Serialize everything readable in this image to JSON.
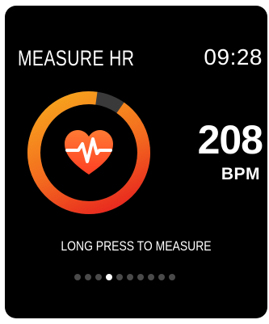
{
  "header": {
    "title": "MEASURE HR",
    "time": "09:28"
  },
  "measurement": {
    "value": "208",
    "unit": "BPM"
  },
  "hint": "LONG PRESS TO MEASURE",
  "pager": {
    "count": 10,
    "active_index": 3
  },
  "colors": {
    "background": "#000000",
    "ring_start": "#f7a21d",
    "ring_end": "#e8271f",
    "ring_track": "#3a3a3a",
    "heart": "#ff5a2a",
    "text": "#ffffff"
  },
  "icons": {
    "center": "heart-pulse-icon"
  }
}
